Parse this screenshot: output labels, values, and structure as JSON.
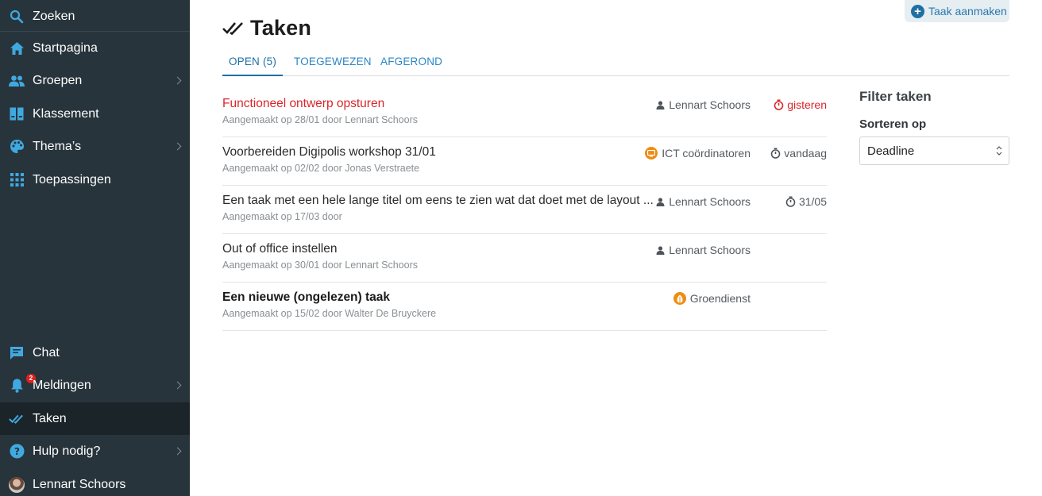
{
  "sidebar": {
    "items": [
      {
        "label": "Zoeken",
        "icon": "search-icon"
      },
      {
        "label": "Startpagina",
        "icon": "home-icon"
      },
      {
        "label": "Groepen",
        "icon": "people-icon"
      },
      {
        "label": "Klassement",
        "icon": "binder-icon"
      },
      {
        "label": "Thema’s",
        "icon": "palette-icon"
      },
      {
        "label": "Toepassingen",
        "icon": "grid-icon"
      },
      {
        "label": "Chat",
        "icon": "chat-icon"
      },
      {
        "label": "Meldingen",
        "icon": "bell-icon",
        "badge": "2"
      },
      {
        "label": "Taken",
        "icon": "double-check-icon"
      },
      {
        "label": "Hulp nodig?",
        "icon": "help-icon"
      },
      {
        "label": "Lennart Schoors",
        "icon": "avatar"
      }
    ]
  },
  "header": {
    "title": "Taken",
    "create_label": "Taak aanmaken"
  },
  "tabs": [
    {
      "label": "OPEN (5)"
    },
    {
      "label": "TOEGEWEZEN"
    },
    {
      "label": "AFGEROND"
    }
  ],
  "tasks": [
    {
      "title": "Functioneel ontwerp opsturen",
      "meta": "Aangemaakt op 28/01 door Lennart Schoors",
      "assignee": "Lennart Schoors",
      "assignee_type": "person",
      "due": "gisteren",
      "overdue": true
    },
    {
      "title": "Voorbereiden Digipolis workshop 31/01",
      "meta": "Aangemaakt op 02/02 door Jonas Verstraete",
      "assignee": "ICT coördinatoren",
      "assignee_type": "group",
      "due": "vandaag"
    },
    {
      "title": "Een taak met een hele lange titel om eens te zien wat dat doet met de layout ...",
      "meta": "Aangemaakt op 17/03 door",
      "assignee": "Lennart Schoors",
      "assignee_type": "person",
      "due": "31/05"
    },
    {
      "title": "Out of office instellen",
      "meta": "Aangemaakt op 30/01 door Lennart Schoors",
      "assignee": "Lennart Schoors",
      "assignee_type": "person",
      "due": ""
    },
    {
      "title": "Een nieuwe (ongelezen) taak",
      "meta": "Aangemaakt op 15/02 door Walter De Bruyckere",
      "assignee": "Groendienst",
      "assignee_type": "group",
      "due": "",
      "unread": true
    }
  ],
  "filter": {
    "title": "Filter taken",
    "sort_label": "Sorteren op",
    "sort_value": "Deadline"
  },
  "colors": {
    "sidebar_bg": "#28343b",
    "accent": "#2a86c6",
    "overdue": "#d9252b",
    "group_badge": "#ef8c12"
  }
}
